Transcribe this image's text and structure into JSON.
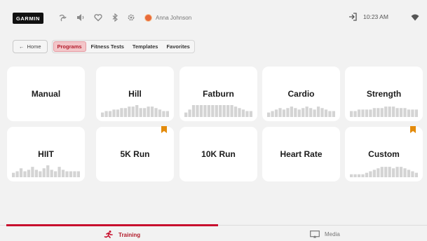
{
  "header": {
    "brand": "GARMIN",
    "user_name": "Anna Johnson",
    "time": "10:23 AM",
    "icons": [
      "fan-icon",
      "speaker-icon",
      "heart-icon",
      "bluetooth-icon",
      "gear-icon"
    ]
  },
  "nav": {
    "home_label": "Home",
    "tabs": [
      {
        "label": "Programs",
        "active": true
      },
      {
        "label": "Fitness Tests",
        "active": false
      },
      {
        "label": "Templates",
        "active": false
      },
      {
        "label": "Favorites",
        "active": false
      }
    ]
  },
  "programs": [
    {
      "title": "Manual",
      "bookmarked": false,
      "profile": []
    },
    {
      "title": "Hill",
      "bookmarked": false,
      "profile": [
        3,
        4,
        4,
        5,
        5,
        6,
        6,
        7,
        7,
        8,
        6,
        6,
        7,
        7,
        6,
        5,
        4,
        4
      ]
    },
    {
      "title": "Fatburn",
      "bookmarked": false,
      "profile": [
        3,
        5,
        8,
        8,
        8,
        8,
        8,
        8,
        8,
        8,
        8,
        8,
        8,
        7,
        6,
        5,
        4,
        4
      ]
    },
    {
      "title": "Cardio",
      "bookmarked": false,
      "profile": [
        3,
        4,
        5,
        6,
        5,
        6,
        7,
        6,
        5,
        6,
        7,
        6,
        5,
        7,
        6,
        5,
        4,
        4
      ]
    },
    {
      "title": "Strength",
      "bookmarked": false,
      "profile": [
        4,
        4,
        5,
        5,
        5,
        5,
        6,
        6,
        6,
        7,
        7,
        7,
        6,
        6,
        6,
        5,
        5,
        5
      ]
    },
    {
      "title": "HIIT",
      "bookmarked": false,
      "profile": [
        3,
        4,
        6,
        4,
        5,
        7,
        5,
        4,
        6,
        8,
        5,
        4,
        7,
        5,
        4,
        4,
        4,
        4
      ]
    },
    {
      "title": "5K Run",
      "bookmarked": true,
      "profile": []
    },
    {
      "title": "10K Run",
      "bookmarked": false,
      "profile": []
    },
    {
      "title": "Heart Rate",
      "bookmarked": false,
      "profile": []
    },
    {
      "title": "Custom",
      "bookmarked": true,
      "profile": [
        2,
        2,
        2,
        2,
        3,
        4,
        5,
        6,
        7,
        7,
        7,
        6,
        7,
        7,
        6,
        5,
        4,
        3
      ]
    }
  ],
  "bottom_nav": {
    "training_label": "Training",
    "media_label": "Media"
  },
  "colors": {
    "accent": "#c8102e",
    "bookmark": "#e38b0c",
    "bar": "#d4d4d4"
  }
}
